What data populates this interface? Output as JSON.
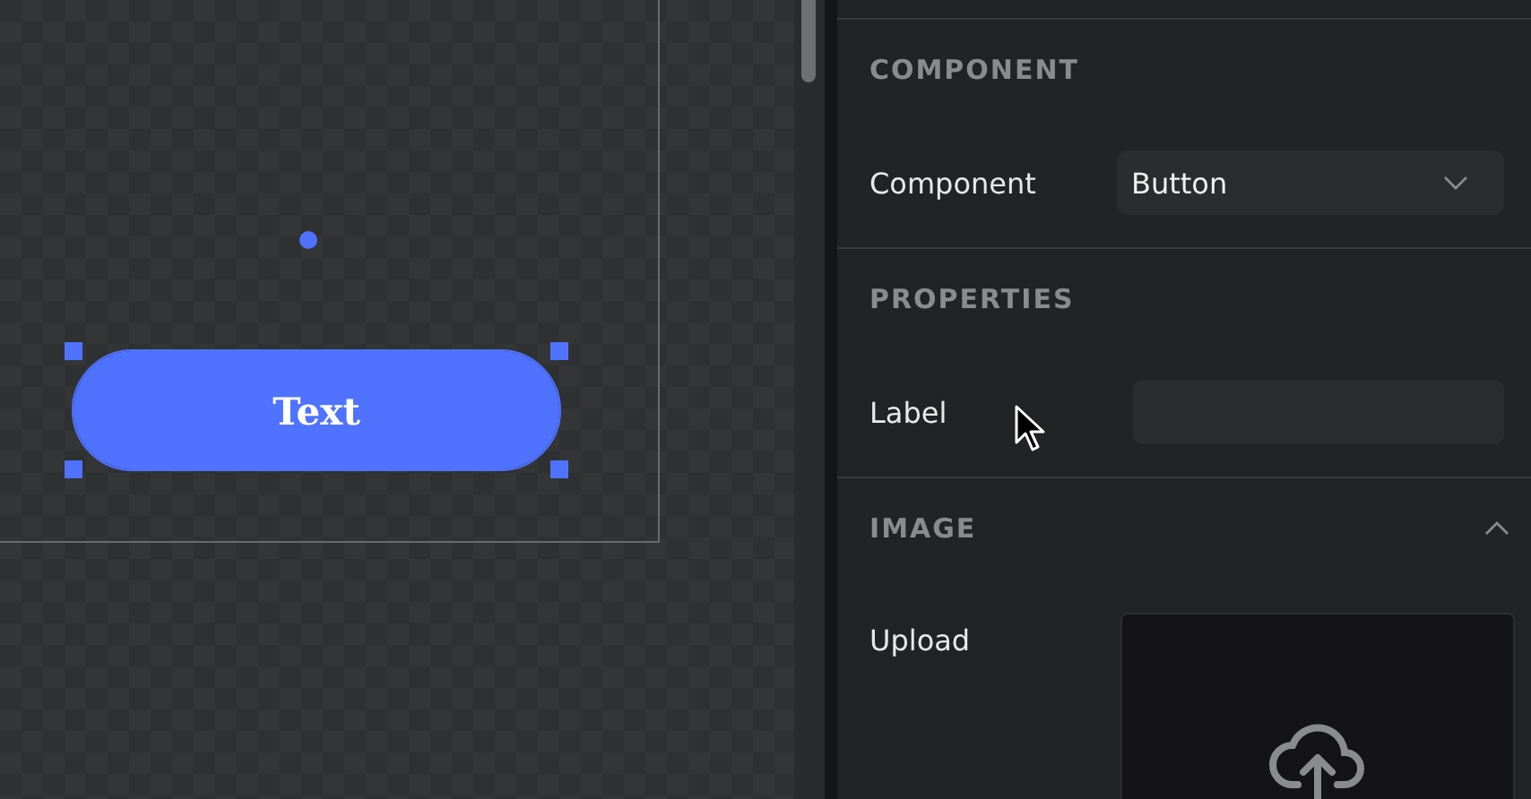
{
  "canvas": {
    "button": {
      "text": "Text",
      "selected": true
    }
  },
  "panel": {
    "sections": [
      {
        "title": "COMPONENT",
        "rows": [
          {
            "kind": "select",
            "label": "Component",
            "value": "Button"
          }
        ]
      },
      {
        "title": "PROPERTIES",
        "rows": [
          {
            "kind": "text",
            "label": "Label"
          }
        ]
      },
      {
        "title": "IMAGE",
        "expanded": true,
        "rows": [
          {
            "kind": "upload",
            "label": "Upload"
          }
        ]
      }
    ]
  }
}
